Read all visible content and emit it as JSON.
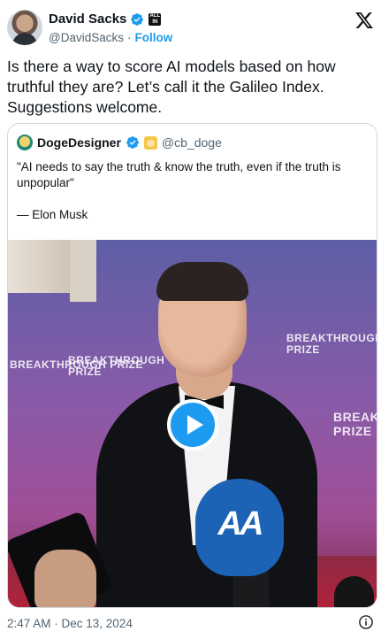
{
  "author": {
    "display_name": "David Sacks",
    "handle": "@DavidSacks",
    "separator": "·",
    "follow_label": "Follow",
    "affiliate_badge": "ALL IN"
  },
  "tweet": {
    "text": "Is there a way to score AI models based on how truthful they are? Let’s call it the Galileo Index. Suggestions welcome.",
    "timestamp": "2:47 AM · Dec 13, 2024"
  },
  "quoted": {
    "display_name": "DogeDesigner",
    "handle": "@cb_doge",
    "quote_line": "\"AI needs to say the truth & know the truth, even if the truth is unpopular\"",
    "attribution": "— Elon Musk"
  },
  "video": {
    "wall_text": [
      "BREAKTHROUGH PRIZE",
      "BREAKTHROUGH PRIZE",
      "BREAKTHROUGH PRIZE",
      "BREAKT PRIZE"
    ],
    "mic_logo": "AA"
  },
  "colors": {
    "accent": "#1d9bf0",
    "text": "#0f1419",
    "secondary": "#536471",
    "border": "#cfd9de"
  },
  "icons": [
    "verified-badge-icon",
    "x-logo-icon",
    "play-icon",
    "info-icon"
  ]
}
